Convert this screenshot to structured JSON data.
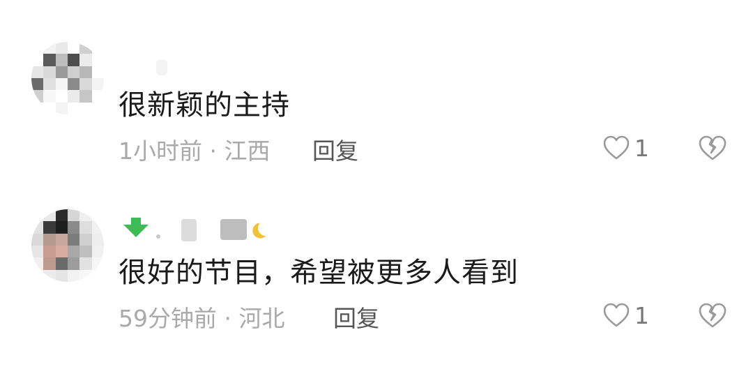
{
  "comments": [
    {
      "text": "很新颖的主持",
      "time_location": "1小时前 · 江西",
      "reply_label": "回复",
      "like_count": "1"
    },
    {
      "text": "很好的节目，希望被更多人看到",
      "time_location": "59分钟前 · 河北",
      "reply_label": "回复",
      "like_count": "1"
    }
  ],
  "colors": {
    "text": "#1a1a1a",
    "meta": "#a9a9a9",
    "reply": "#555555",
    "icon": "#9a9a9a",
    "badge_green": "#3dbb54",
    "badge_yellow": "#f0c234"
  },
  "icons": [
    "heart-outline-icon",
    "broken-heart-icon",
    "level-badge-icon"
  ]
}
